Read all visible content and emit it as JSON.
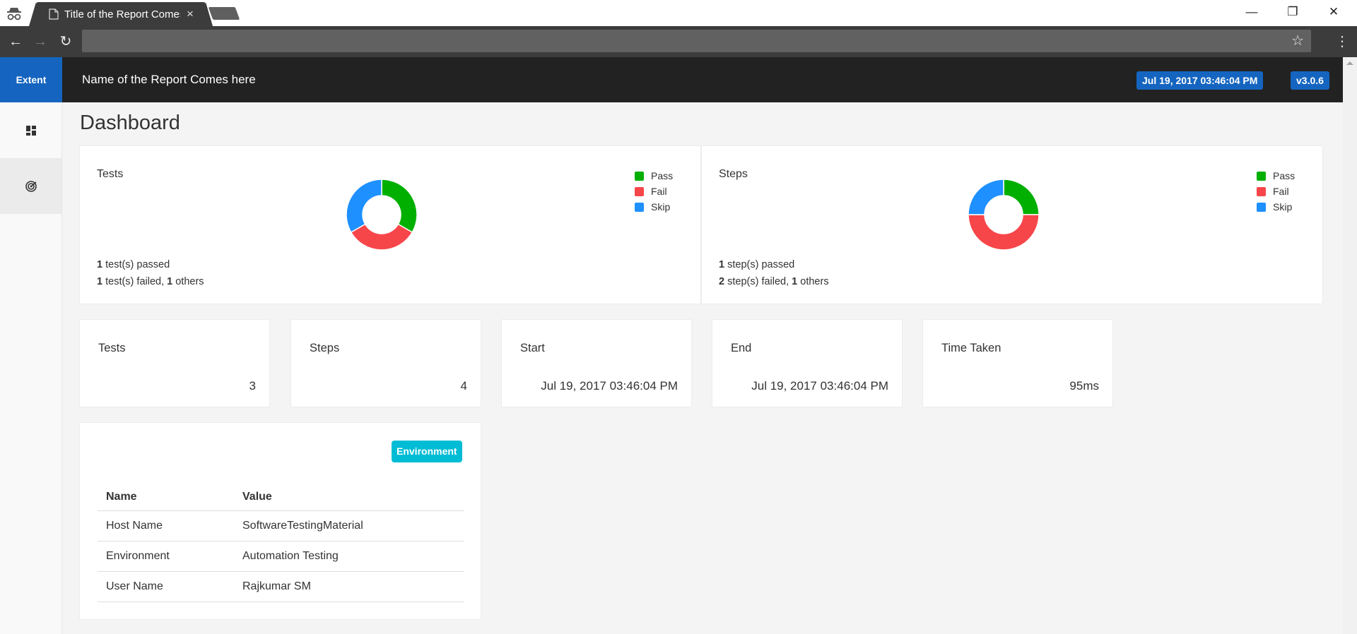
{
  "browser": {
    "tab_title": "Title of the Report Comes here",
    "tab_close": "×",
    "window_controls": {
      "minimize": "—",
      "restore": "❐",
      "close": "✕"
    },
    "nav": {
      "back": "←",
      "forward": "→",
      "reload": "↻",
      "bookmark": "☆",
      "menu": "⋮"
    },
    "address": ""
  },
  "header": {
    "brand": "Extent",
    "report_name": "Name of the Report Comes here",
    "timestamp": "Jul 19, 2017 03:46:04 PM",
    "version": "v3.0.6"
  },
  "sidebar": {
    "items": [
      {
        "icon": "dashboard-icon"
      },
      {
        "icon": "radar-icon",
        "active": true
      }
    ]
  },
  "dashboard": {
    "title": "Dashboard",
    "colors": {
      "pass": "#00af00",
      "fail": "#f7464a",
      "skip": "#1e90ff"
    },
    "tests_panel": {
      "title": "Tests",
      "legend": [
        "Pass",
        "Fail",
        "Skip"
      ],
      "line1": {
        "count": "1",
        "text": " test(s) passed"
      },
      "line2": {
        "count": "1",
        "text": " test(s) failed, ",
        "others_count": "1",
        "others_text": " others"
      }
    },
    "steps_panel": {
      "title": "Steps",
      "legend": [
        "Pass",
        "Fail",
        "Skip"
      ],
      "line1": {
        "count": "1",
        "text": " step(s) passed"
      },
      "line2": {
        "count": "2",
        "text": " step(s) failed, ",
        "others_count": "1",
        "others_text": " others"
      }
    },
    "stats": [
      {
        "label": "Tests",
        "value": "3"
      },
      {
        "label": "Steps",
        "value": "4"
      },
      {
        "label": "Start",
        "value": "Jul 19, 2017 03:46:04 PM"
      },
      {
        "label": "End",
        "value": "Jul 19, 2017 03:46:04 PM"
      },
      {
        "label": "Time Taken",
        "value": "95ms"
      }
    ],
    "environment": {
      "badge": "Environment",
      "headers": [
        "Name",
        "Value"
      ],
      "rows": [
        [
          "Host Name",
          "SoftwareTestingMaterial"
        ],
        [
          "Environment",
          "Automation Testing"
        ],
        [
          "User Name",
          "Rajkumar SM"
        ]
      ]
    }
  },
  "chart_data": [
    {
      "type": "pie",
      "title": "Tests",
      "categories": [
        "Pass",
        "Fail",
        "Skip"
      ],
      "values": [
        1,
        1,
        1
      ],
      "legend_position": "top-right"
    },
    {
      "type": "pie",
      "title": "Steps",
      "categories": [
        "Pass",
        "Fail",
        "Skip"
      ],
      "values": [
        1,
        2,
        1
      ],
      "legend_position": "top-right"
    }
  ]
}
